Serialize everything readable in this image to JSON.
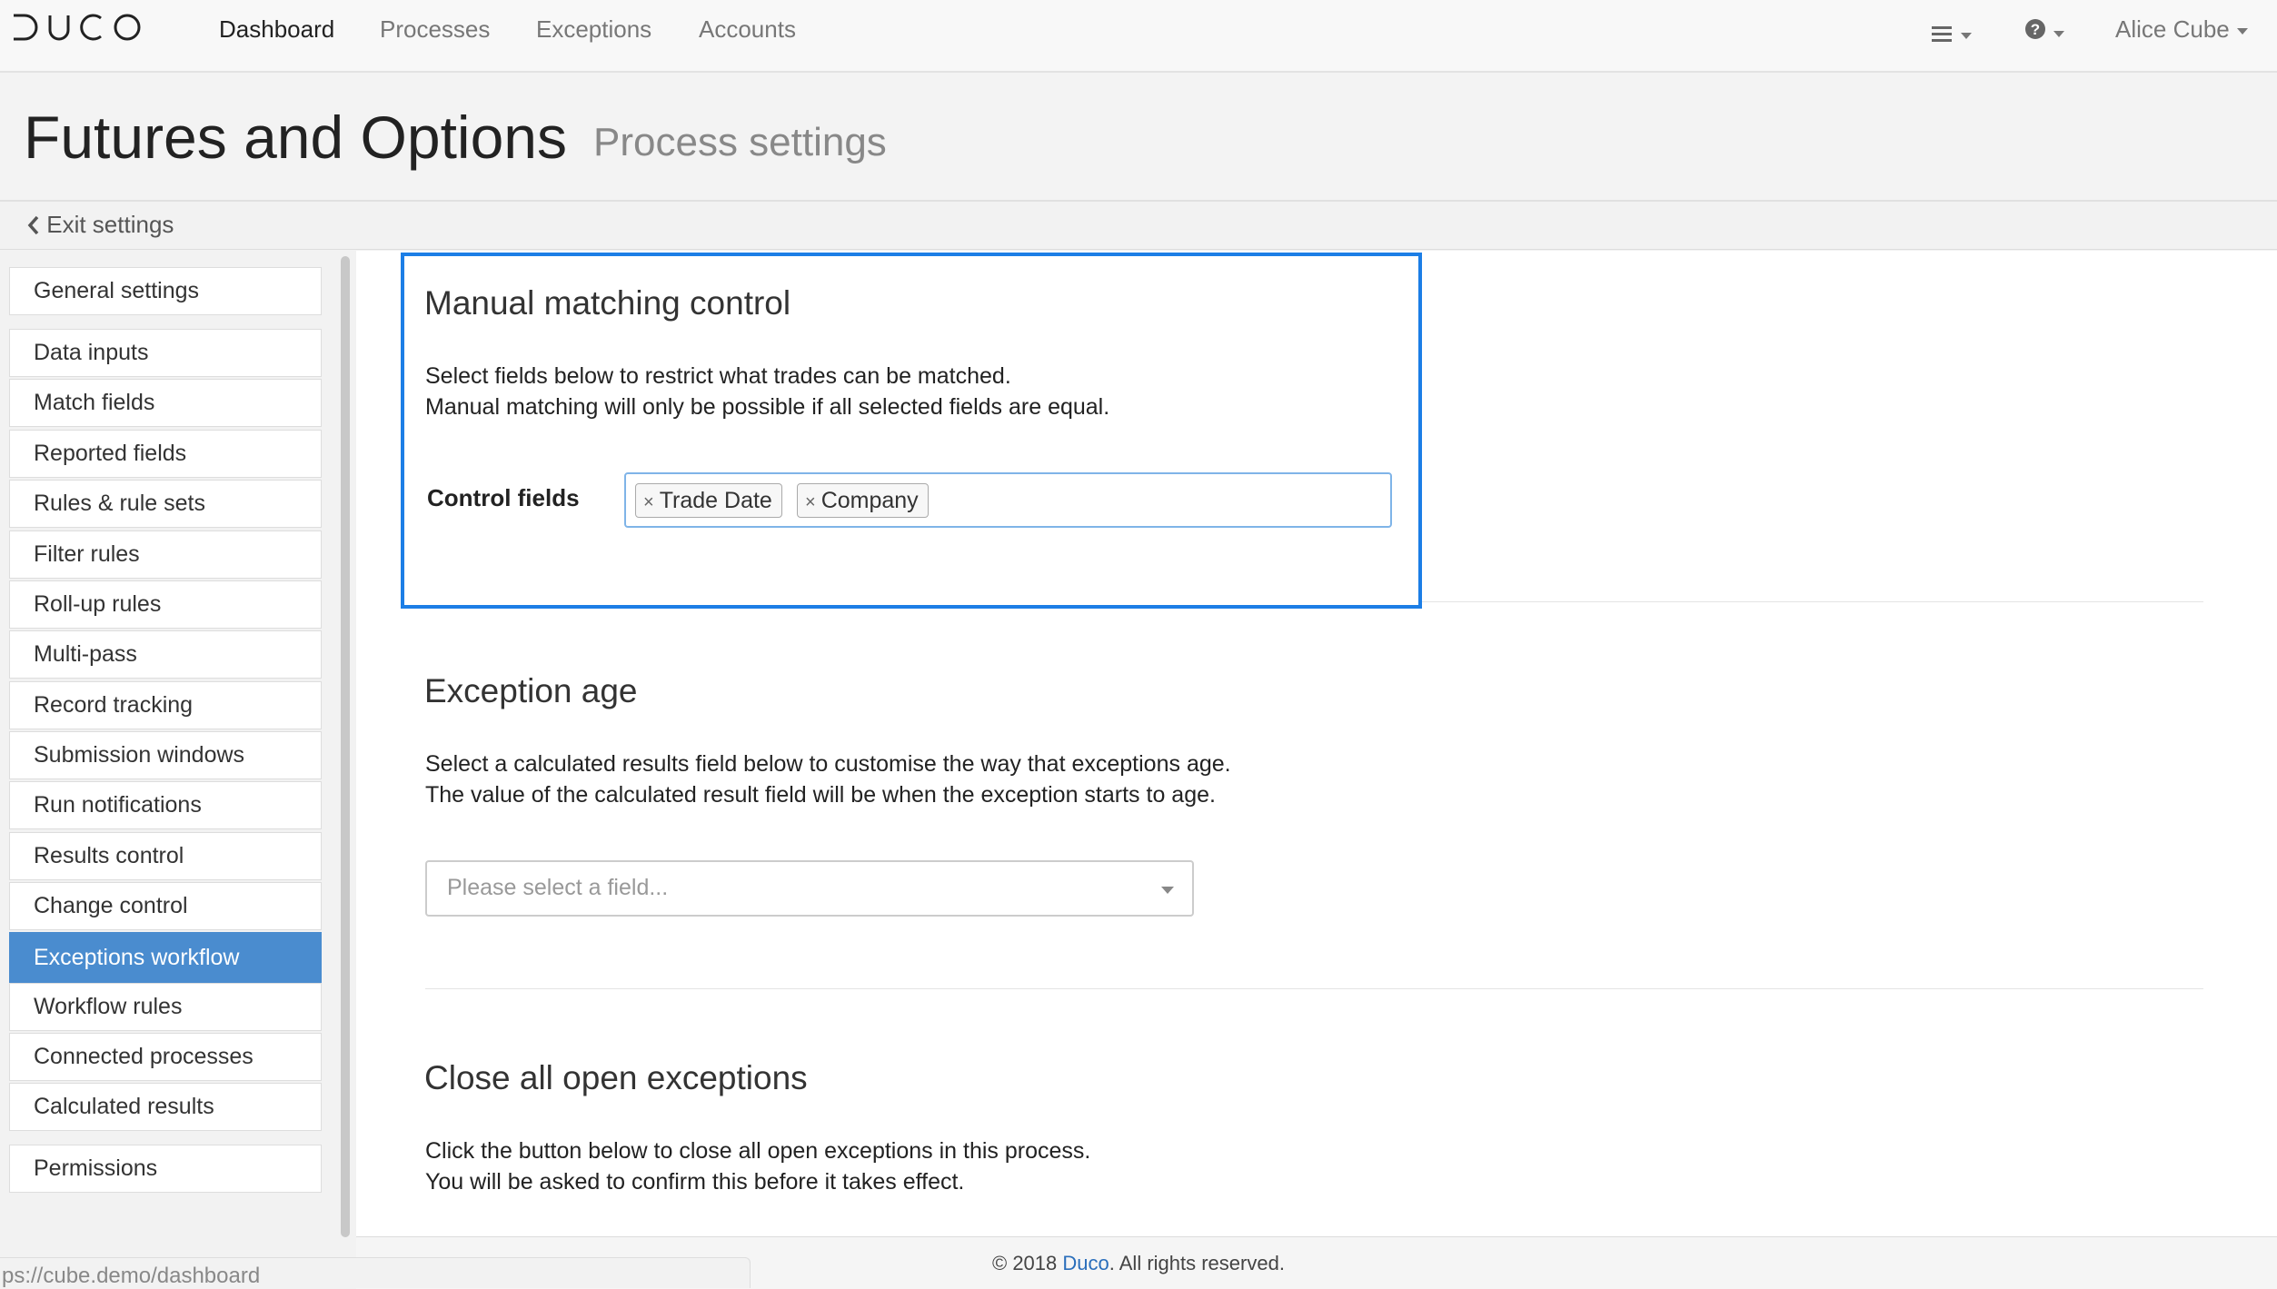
{
  "nav": {
    "logo_text": "DUCO",
    "items": [
      "Dashboard",
      "Processes",
      "Exceptions",
      "Accounts"
    ],
    "user_name": "Alice Cube",
    "menu_icon": "hamburger-icon",
    "help_icon": "question-circle-icon"
  },
  "header": {
    "title": "Futures and Options",
    "subtitle": "Process settings"
  },
  "exit_label": "Exit settings",
  "sidebar": {
    "items": [
      "General settings",
      "Data inputs",
      "Match fields",
      "Reported fields",
      "Rules & rule sets",
      "Filter rules",
      "Roll-up rules",
      "Multi-pass",
      "Record tracking",
      "Submission windows",
      "Run notifications",
      "Results control",
      "Change control",
      "Exceptions workflow",
      "Workflow rules",
      "Connected processes",
      "Calculated results",
      "Permissions"
    ],
    "active": "Exceptions workflow",
    "active_color": "#4a8ccf"
  },
  "manual_matching": {
    "title": "Manual matching control",
    "line1": "Select fields below to restrict what trades can be matched.",
    "line2": "Manual matching will only be possible if all selected fields are equal.",
    "control_label": "Control fields",
    "tags": [
      "Trade Date",
      "Company"
    ],
    "highlight_color": "#1c7ee6"
  },
  "exception_age": {
    "title": "Exception age",
    "line1": "Select a calculated results field below to customise the way that exceptions age.",
    "line2": "The value of the calculated result field will be when the exception starts to age.",
    "placeholder": "Please select a field..."
  },
  "close_all": {
    "title": "Close all open exceptions",
    "line1": "Click the button below to close all open exceptions in this process.",
    "line2": "You will be asked to confirm this before it takes effect."
  },
  "footer": {
    "prefix": "© 2018 ",
    "link": "Duco",
    "suffix": ". All rights reserved."
  },
  "status_url": "ps://cube.demo/dashboard"
}
